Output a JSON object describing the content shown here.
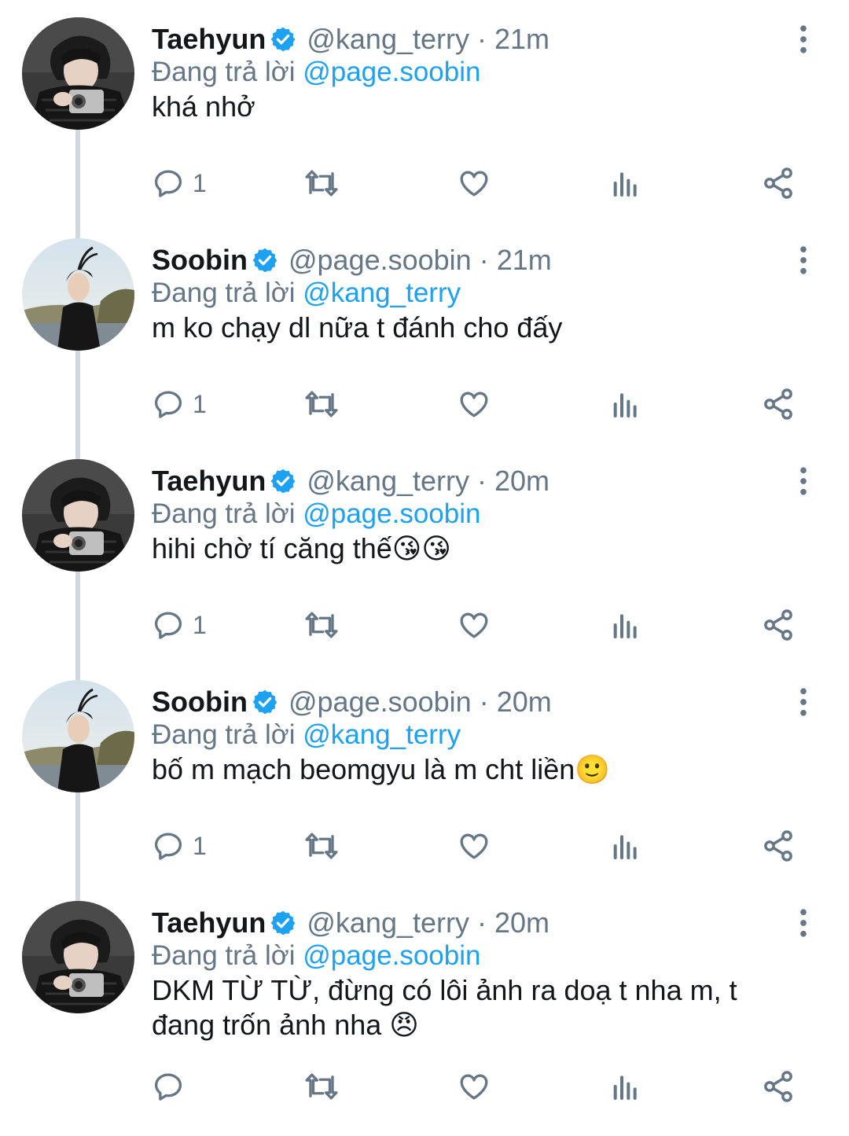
{
  "replying_prefix": "Đang trả lời",
  "tweets": [
    {
      "name": "Taehyun",
      "handle": "@kang_terry",
      "separator": "·",
      "time": "21m",
      "reply_to": "@page.soobin",
      "text": "khá nhở",
      "reply_count": "1",
      "avatar": "taehyun-avatar"
    },
    {
      "name": "Soobin",
      "handle": "@page.soobin",
      "separator": "·",
      "time": "21m",
      "reply_to": "@kang_terry",
      "text": "m ko chạy dl nữa t đánh cho đấy",
      "reply_count": "1",
      "avatar": "soobin-avatar"
    },
    {
      "name": "Taehyun",
      "handle": "@kang_terry",
      "separator": "·",
      "time": "20m",
      "reply_to": "@page.soobin",
      "text": "hihi chờ tí căng thế😘😘",
      "reply_count": "1",
      "avatar": "taehyun-avatar"
    },
    {
      "name": "Soobin",
      "handle": "@page.soobin",
      "separator": "·",
      "time": "20m",
      "reply_to": "@kang_terry",
      "text": "bố m mạch beomgyu là m cht liền🙂",
      "reply_count": "1",
      "avatar": "soobin-avatar"
    },
    {
      "name": "Taehyun",
      "handle": "@kang_terry",
      "separator": "·",
      "time": "20m",
      "reply_to": "@page.soobin",
      "text": "DKM TỪ TỪ, đừng có lôi ảnh ra doạ t nha m, t đang trốn ảnh nha 😠",
      "reply_count": "",
      "avatar": "taehyun-avatar"
    }
  ],
  "colors": {
    "text": "#14171a",
    "secondary": "#657786",
    "link": "#1da1f2",
    "verified": "#1da1f2",
    "thread_line": "#cfd9de"
  },
  "icons": {
    "reply": "reply-icon",
    "retweet": "retweet-icon",
    "like": "heart-icon",
    "analytics": "analytics-icon",
    "share": "share-icon",
    "more": "more-vertical-icon",
    "verified": "verified-badge-icon"
  }
}
